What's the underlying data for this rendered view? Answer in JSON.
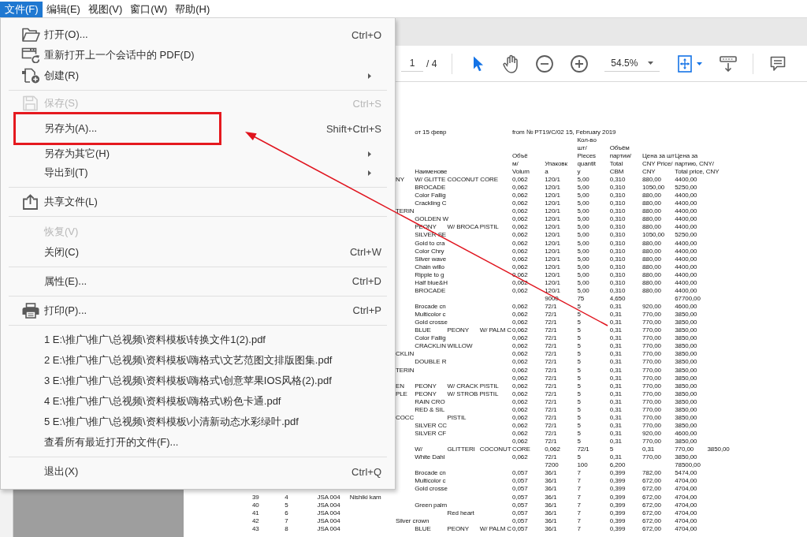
{
  "menubar": [
    {
      "label": "文件(F)",
      "selected": true
    },
    {
      "label": "编辑(E)",
      "selected": false
    },
    {
      "label": "视图(V)",
      "selected": false
    },
    {
      "label": "窗口(W)",
      "selected": false
    },
    {
      "label": "帮助(H)",
      "selected": false
    }
  ],
  "file_menu": {
    "groups": [
      [
        {
          "kind": "open",
          "label": "打开(O)...",
          "shortcut": "Ctrl+O",
          "submenu": false,
          "disabled": false,
          "boxed": false
        },
        {
          "kind": "reopen",
          "label": "重新打开上一个会话中的 PDF(D)",
          "submenu": false,
          "disabled": false,
          "boxed": false
        },
        {
          "kind": "create",
          "label": "创建(R)",
          "submenu": true,
          "disabled": false,
          "boxed": false
        }
      ],
      [
        {
          "kind": "save",
          "label": "保存(S)",
          "shortcut": "Ctrl+S",
          "submenu": false,
          "disabled": true,
          "boxed": false
        },
        {
          "kind": "plain",
          "label": "另存为(A)...",
          "shortcut": "Shift+Ctrl+S",
          "submenu": false,
          "disabled": false,
          "boxed": true
        },
        {
          "kind": "plain",
          "label": "另存为其它(H)",
          "submenu": true,
          "disabled": false,
          "boxed": false
        },
        {
          "kind": "plain",
          "label": "导出到(T)",
          "submenu": true,
          "disabled": false,
          "boxed": false
        }
      ],
      [
        {
          "kind": "share",
          "label": "共享文件(L)",
          "submenu": false,
          "disabled": false,
          "boxed": false
        }
      ],
      [
        {
          "kind": "plain",
          "label": "恢复(V)",
          "submenu": false,
          "disabled": true,
          "boxed": false
        },
        {
          "kind": "plain",
          "label": "关闭(C)",
          "shortcut": "Ctrl+W",
          "submenu": false,
          "disabled": false,
          "boxed": false
        }
      ],
      [
        {
          "kind": "plain",
          "label": "属性(E)...",
          "shortcut": "Ctrl+D",
          "submenu": false,
          "disabled": false,
          "boxed": false
        }
      ],
      [
        {
          "kind": "print",
          "label": "打印(P)...",
          "shortcut": "Ctrl+P",
          "submenu": false,
          "disabled": false,
          "boxed": false
        }
      ],
      [
        {
          "kind": "plain",
          "label": "1 E:\\推广\\推广\\总视频\\资料模板\\转换文件1(2).pdf",
          "submenu": false,
          "disabled": false,
          "boxed": false
        },
        {
          "kind": "plain",
          "label": "2 E:\\推广\\推广\\总视频\\资料模板\\嗨格式\\文艺范图文排版图集.pdf",
          "submenu": false,
          "disabled": false,
          "boxed": false
        },
        {
          "kind": "plain",
          "label": "3 E:\\推广\\推广\\总视频\\资料模板\\嗨格式\\创意苹果IOS风格(2).pdf",
          "submenu": false,
          "disabled": false,
          "boxed": false
        },
        {
          "kind": "plain",
          "label": "4 E:\\推广\\推广\\总视频\\资料模板\\嗨格式\\粉色卡通.pdf",
          "submenu": false,
          "disabled": false,
          "boxed": false
        },
        {
          "kind": "plain",
          "label": "5 E:\\推广\\推广\\总视频\\资料模板\\小清新动态水彩绿叶.pdf",
          "submenu": false,
          "disabled": false,
          "boxed": false
        },
        {
          "kind": "plain",
          "label": "查看所有最近打开的文件(F)...",
          "submenu": false,
          "disabled": false,
          "boxed": false
        }
      ],
      [
        {
          "kind": "plain",
          "label": "退出(X)",
          "shortcut": "Ctrl+Q",
          "submenu": false,
          "disabled": false,
          "boxed": false
        }
      ]
    ]
  },
  "toolbar": {
    "page_field": {
      "value": "1"
    },
    "page_count": "/ 4",
    "tools": [
      {
        "kind": "select",
        "selected": true
      },
      {
        "kind": "hand",
        "selected": false
      }
    ],
    "zoom_field": {
      "value": "54.5%"
    }
  },
  "document": {
    "title_left": "от 15 февр",
    "title_right": "from № PT19/C/02 15, February 2019",
    "columns": {
      "name": [
        "Наименове"
      ],
      "volume": [
        "Объё",
        "м/",
        "Volum"
      ],
      "packing": [
        "Упаковк",
        "а"
      ],
      "pieces": [
        "Кол-во",
        "шт/",
        "Pieces",
        "quantit",
        "y"
      ],
      "total_cbm": [
        "Объём",
        "партии/",
        "Total",
        "CBM"
      ],
      "unit_price": [
        "Цена за шт",
        "CNY Price/",
        "CNY"
      ],
      "total_price": [
        "Цена за",
        "партию, CNY/",
        "Total price, CNY"
      ]
    },
    "rows": [
      {
        "column_5": "NY",
        "name": "W/ GLITTE",
        "column_7": "COCONUT CORE",
        "volume": "0,062",
        "packing": "120/1",
        "pieces": "5,00",
        "total_cbm": "0,310",
        "unit_price": "880,00",
        "total_price": "4400,00"
      },
      {
        "name": "BROCADE",
        "volume": "0,062",
        "packing": "120/1",
        "pieces": "5,00",
        "total_cbm": "0,310",
        "unit_price": "1050,00",
        "total_price": "5250,00"
      },
      {
        "name": "Color Fallig",
        "volume": "0,062",
        "packing": "120/1",
        "pieces": "5,00",
        "total_cbm": "0,310",
        "unit_price": "880,00",
        "total_price": "4400,00"
      },
      {
        "name": "Crackling C",
        "volume": "0,062",
        "packing": "120/1",
        "pieces": "5,00",
        "total_cbm": "0,310",
        "unit_price": "880,00",
        "total_price": "4400,00"
      },
      {
        "column_5": "TERIN",
        "volume": "0,062",
        "packing": "120/1",
        "pieces": "5,00",
        "total_cbm": "0,310",
        "unit_price": "880,00",
        "total_price": "4400,00"
      },
      {
        "name": "GOLDEN W",
        "volume": "0,062",
        "packing": "120/1",
        "pieces": "5,00",
        "total_cbm": "0,310",
        "unit_price": "880,00",
        "total_price": "4400,00"
      },
      {
        "name": "PEONY",
        "column_7": "W/ BROCA PISTIL",
        "volume": "0,062",
        "packing": "120/1",
        "pieces": "5,00",
        "total_cbm": "0,310",
        "unit_price": "880,00",
        "total_price": "4400,00"
      },
      {
        "name": "SILVER SE",
        "volume": "0,062",
        "packing": "120/1",
        "pieces": "5,00",
        "total_cbm": "0,310",
        "unit_price": "1050,00",
        "total_price": "5250,00"
      },
      {
        "name": "Gold to cra",
        "volume": "0,062",
        "packing": "120/1",
        "pieces": "5,00",
        "total_cbm": "0,310",
        "unit_price": "880,00",
        "total_price": "4400,00"
      },
      {
        "name": "Color Chry",
        "volume": "0,062",
        "packing": "120/1",
        "pieces": "5,00",
        "total_cbm": "0,310",
        "unit_price": "880,00",
        "total_price": "4400,00"
      },
      {
        "name": "Silver wave",
        "volume": "0,062",
        "packing": "120/1",
        "pieces": "5,00",
        "total_cbm": "0,310",
        "unit_price": "880,00",
        "total_price": "4400,00"
      },
      {
        "name": "Chain willo",
        "volume": "0,062",
        "packing": "120/1",
        "pieces": "5,00",
        "total_cbm": "0,310",
        "unit_price": "880,00",
        "total_price": "4400,00"
      },
      {
        "name": "Ripple to g",
        "volume": "0,062",
        "packing": "120/1",
        "pieces": "5,00",
        "total_cbm": "0,310",
        "unit_price": "880,00",
        "total_price": "4400,00"
      },
      {
        "name": "Half blue&H",
        "volume": "0,062",
        "packing": "120/1",
        "pieces": "5,00",
        "total_cbm": "0,310",
        "unit_price": "880,00",
        "total_price": "4400,00"
      },
      {
        "name": "BROCADE",
        "volume": "0,062",
        "packing": "120/1",
        "pieces": "5,00",
        "total_cbm": "0,310",
        "unit_price": "880,00",
        "total_price": "4400,00"
      },
      {
        "packing": "9000",
        "pieces": "75",
        "total_cbm": "4,650",
        "total_price": "67700,00"
      },
      {
        "name": "Brocade cn",
        "volume": "0,062",
        "packing": "72/1",
        "pieces": "5",
        "total_cbm": "0,31",
        "unit_price": "920,00",
        "total_price": "4600,00"
      },
      {
        "name": "Multicolor c",
        "volume": "0,062",
        "packing": "72/1",
        "pieces": "5",
        "total_cbm": "0,31",
        "unit_price": "770,00",
        "total_price": "3850,00"
      },
      {
        "name": "Gold crosse",
        "volume": "0,062",
        "packing": "72/1",
        "pieces": "5",
        "total_cbm": "0,31",
        "unit_price": "770,00",
        "total_price": "3850,00"
      },
      {
        "name": "BLUE",
        "column_7": "PEONY",
        "column_8": "W/ PALM C",
        "volume": "0,062",
        "packing": "72/1",
        "pieces": "5",
        "total_cbm": "0,31",
        "unit_price": "770,00",
        "total_price": "3850,00"
      },
      {
        "name": "Color Fallig",
        "volume": "0,062",
        "packing": "72/1",
        "pieces": "5",
        "total_cbm": "0,31",
        "unit_price": "770,00",
        "total_price": "3850,00"
      },
      {
        "name": "CRACKLIN",
        "column_7": "WILLOW",
        "volume": "0,062",
        "packing": "72/1",
        "pieces": "5",
        "total_cbm": "0,31",
        "unit_price": "770,00",
        "total_price": "3850,00"
      },
      {
        "column_5": "CKLIN",
        "volume": "0,062",
        "packing": "72/1",
        "pieces": "5",
        "total_cbm": "0,31",
        "unit_price": "770,00",
        "total_price": "3850,00"
      },
      {
        "name": "DOUBLE R",
        "volume": "0,062",
        "packing": "72/1",
        "pieces": "5",
        "total_cbm": "0,31",
        "unit_price": "770,00",
        "total_price": "3850,00"
      },
      {
        "column_5": "TERIN",
        "volume": "0,062",
        "packing": "72/1",
        "pieces": "5",
        "total_cbm": "0,31",
        "unit_price": "770,00",
        "total_price": "3850,00"
      },
      {
        "volume": "0,062",
        "packing": "72/1",
        "pieces": "5",
        "total_cbm": "0,31",
        "unit_price": "770,00",
        "total_price": "3850,00"
      },
      {
        "column_5": "EN",
        "name": "PEONY",
        "column_7": "W/ CRACK PISTIL",
        "volume": "0,062",
        "packing": "72/1",
        "pieces": "5",
        "total_cbm": "0,31",
        "unit_price": "770,00",
        "total_price": "3850,00"
      },
      {
        "column_5": "PLE",
        "name": "PEONY",
        "column_7": "W/ STROB PISTIL",
        "volume": "0,062",
        "packing": "72/1",
        "pieces": "5",
        "total_cbm": "0,31",
        "unit_price": "770,00",
        "total_price": "3850,00"
      },
      {
        "name": "RAIN CRO",
        "volume": "0,062",
        "packing": "72/1",
        "pieces": "5",
        "total_cbm": "0,31",
        "unit_price": "770,00",
        "total_price": "3850,00"
      },
      {
        "name": "RED & SIL",
        "volume": "0,062",
        "packing": "72/1",
        "pieces": "5",
        "total_cbm": "0,31",
        "unit_price": "770,00",
        "total_price": "3850,00"
      },
      {
        "column_5": "COCC",
        "column_7": "PISTIL",
        "volume": "0,062",
        "packing": "72/1",
        "pieces": "5",
        "total_cbm": "0,31",
        "unit_price": "770,00",
        "total_price": "3850,00"
      },
      {
        "name": "SILVER CC",
        "volume": "0,062",
        "packing": "72/1",
        "pieces": "5",
        "total_cbm": "0,31",
        "unit_price": "770,00",
        "total_price": "3850,00"
      },
      {
        "name": "SILVER CF",
        "volume": "0,062",
        "packing": "72/1",
        "pieces": "5",
        "total_cbm": "0,31",
        "unit_price": "920,00",
        "total_price": "4600,00"
      },
      {
        "volume": "0,062",
        "packing": "72/1",
        "pieces": "5",
        "total_cbm": "0,31",
        "unit_price": "770,00",
        "total_price": "3850,00"
      },
      {
        "name": "W/",
        "column_7": "GLITTERI",
        "column_8": "COCONUT",
        "volume": "CORE",
        "packing": "0,062",
        "pieces": "72/1",
        "total_cbm": "5",
        "unit_price": "0,31",
        "total_price": "770,00",
        "column_15": "3850,00"
      },
      {
        "name": "White Dahl",
        "volume": "0,062",
        "packing": "72/1",
        "pieces": "5",
        "total_cbm": "0,31",
        "unit_price": "770,00",
        "total_price": "3850,00"
      },
      {
        "packing": "7200",
        "pieces": "100",
        "total_cbm": "6,200",
        "total_price": "78500,00"
      },
      {
        "name": "Brocade cn",
        "volume": "0,057",
        "packing": "36/1",
        "pieces": "7",
        "total_cbm": "0,399",
        "unit_price": "782,00",
        "total_price": "5474,00"
      },
      {
        "name": "Multicolor c",
        "volume": "0,057",
        "packing": "36/1",
        "pieces": "7",
        "total_cbm": "0,399",
        "unit_price": "672,00",
        "total_price": "4704,00"
      },
      {
        "name": "Gold crosse",
        "volume": "0,057",
        "packing": "36/1",
        "pieces": "7",
        "total_cbm": "0,399",
        "unit_price": "672,00",
        "total_price": "4704,00"
      },
      {
        "column_1": "39",
        "column_2": "4",
        "column_3": "JSA 004",
        "column_4": "Nishiki kam",
        "volume": "0,057",
        "packing": "36/1",
        "pieces": "7",
        "total_cbm": "0,399",
        "unit_price": "672,00",
        "total_price": "4704,00"
      },
      {
        "column_1": "40",
        "column_2": "5",
        "column_3": "JSA 004",
        "name": "Green palm",
        "volume": "0,057",
        "packing": "36/1",
        "pieces": "7",
        "total_cbm": "0,399",
        "unit_price": "672,00",
        "total_price": "4704,00"
      },
      {
        "column_1": "41",
        "column_2": "6",
        "column_3": "JSA 004",
        "column_7": "Red heart",
        "volume": "0,057",
        "packing": "36/1",
        "pieces": "7",
        "total_cbm": "0,399",
        "unit_price": "672,00",
        "total_price": "4704,00"
      },
      {
        "column_1": "42",
        "column_2": "7",
        "column_3": "JSA 004",
        "column_5": "Silver crown",
        "volume": "0,057",
        "packing": "36/1",
        "pieces": "7",
        "total_cbm": "0,399",
        "unit_price": "672,00",
        "total_price": "4704,00"
      },
      {
        "column_1": "43",
        "column_2": "8",
        "column_3": "JSA 004",
        "name": "BLUE",
        "column_7": "PEONY",
        "column_8": "W/ PALM C",
        "volume": "0,057",
        "packing": "36/1",
        "pieces": "7",
        "total_cbm": "0,399",
        "unit_price": "672,00",
        "total_price": "4704,00"
      }
    ]
  }
}
